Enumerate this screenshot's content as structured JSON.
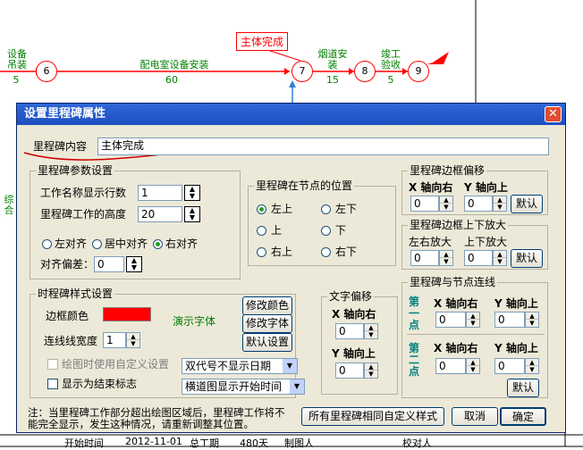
{
  "background": {
    "labels": {
      "equipment_install": "设备\n吊装",
      "equipment_dur": "5",
      "power_room": "配电室设备安装",
      "power_room_dur": "60",
      "flue": "烟道安\n装",
      "flue_dur": "15",
      "complete": "竣工\n验收",
      "complete_dur": "5",
      "side_text": "综合"
    },
    "nodes": [
      "6",
      "7",
      "8",
      "9"
    ],
    "milestone_label": "主体完成",
    "bottom_row": [
      "开始时间",
      "2012-11-01",
      "总工期",
      "480天",
      "制图人",
      "校对人"
    ]
  },
  "dialog": {
    "title": "设置里程碑属性",
    "content_label": "里程碑内容",
    "content_value": "主体完成",
    "params": {
      "title": "里程碑参数设置",
      "rows_label": "工作名称显示行数",
      "rows_value": "1",
      "height_label": "里程碑工作的高度",
      "height_value": "20",
      "align_left": "左对齐",
      "align_center": "居中对齐",
      "align_right": "右对齐",
      "offset_label": "对齐偏差：",
      "offset_value": "0"
    },
    "position": {
      "title": "里程碑在节点的位置",
      "options": [
        "左上",
        "左下",
        "上",
        "下",
        "右上",
        "右下"
      ],
      "selected": "左上"
    },
    "frame_offset": {
      "title": "里程碑边框偏移",
      "x_label": "X 轴向右",
      "y_label": "Y 轴向上",
      "x_value": "0",
      "y_value": "0",
      "default_label": "默认"
    },
    "frame_scale": {
      "title": "里程碑边框上下放大",
      "lr_label": "左右放大",
      "ud_label": "上下放大",
      "lr_value": "0",
      "ud_value": "0",
      "default_label": "默认"
    },
    "style": {
      "title": "时程碑样式设置",
      "border_color_label": "边框颜色",
      "border_color": "#ff0000",
      "demo_font": "演示字体",
      "line_width_label": "连线线宽度",
      "line_width_value": "1",
      "modify_color": "修改颜色",
      "modify_font": "修改字体",
      "default_settings": "默认设置",
      "custom_setting_label": "绘图时使用自定义设置",
      "end_mark_label": "显示为结束标志",
      "date_select": "双代号不显示日期",
      "time_select": "横道图显示开始时间"
    },
    "text_offset": {
      "title": "文字偏移",
      "x_label": "X 轴向右",
      "y_label": "Y 轴向上",
      "x_value": "0",
      "y_value": "0"
    },
    "node_link": {
      "title": "里程碑与节点连线",
      "first_point": "第一点",
      "second_point": "第二点",
      "x_label": "X 轴向右",
      "y_label": "Y 轴向上",
      "p1x": "0",
      "p1y": "0",
      "p2x": "0",
      "p2y": "0",
      "default_label": "默认"
    },
    "note": "注：当里程碑工作部分超出绘图区域后，里程碑工作将不能完全显示，发生这种情况，请重新调整其位置。",
    "same_style_button": "所有里程碑相同自定义样式",
    "cancel_button": "取消",
    "ok_button": "确定"
  }
}
